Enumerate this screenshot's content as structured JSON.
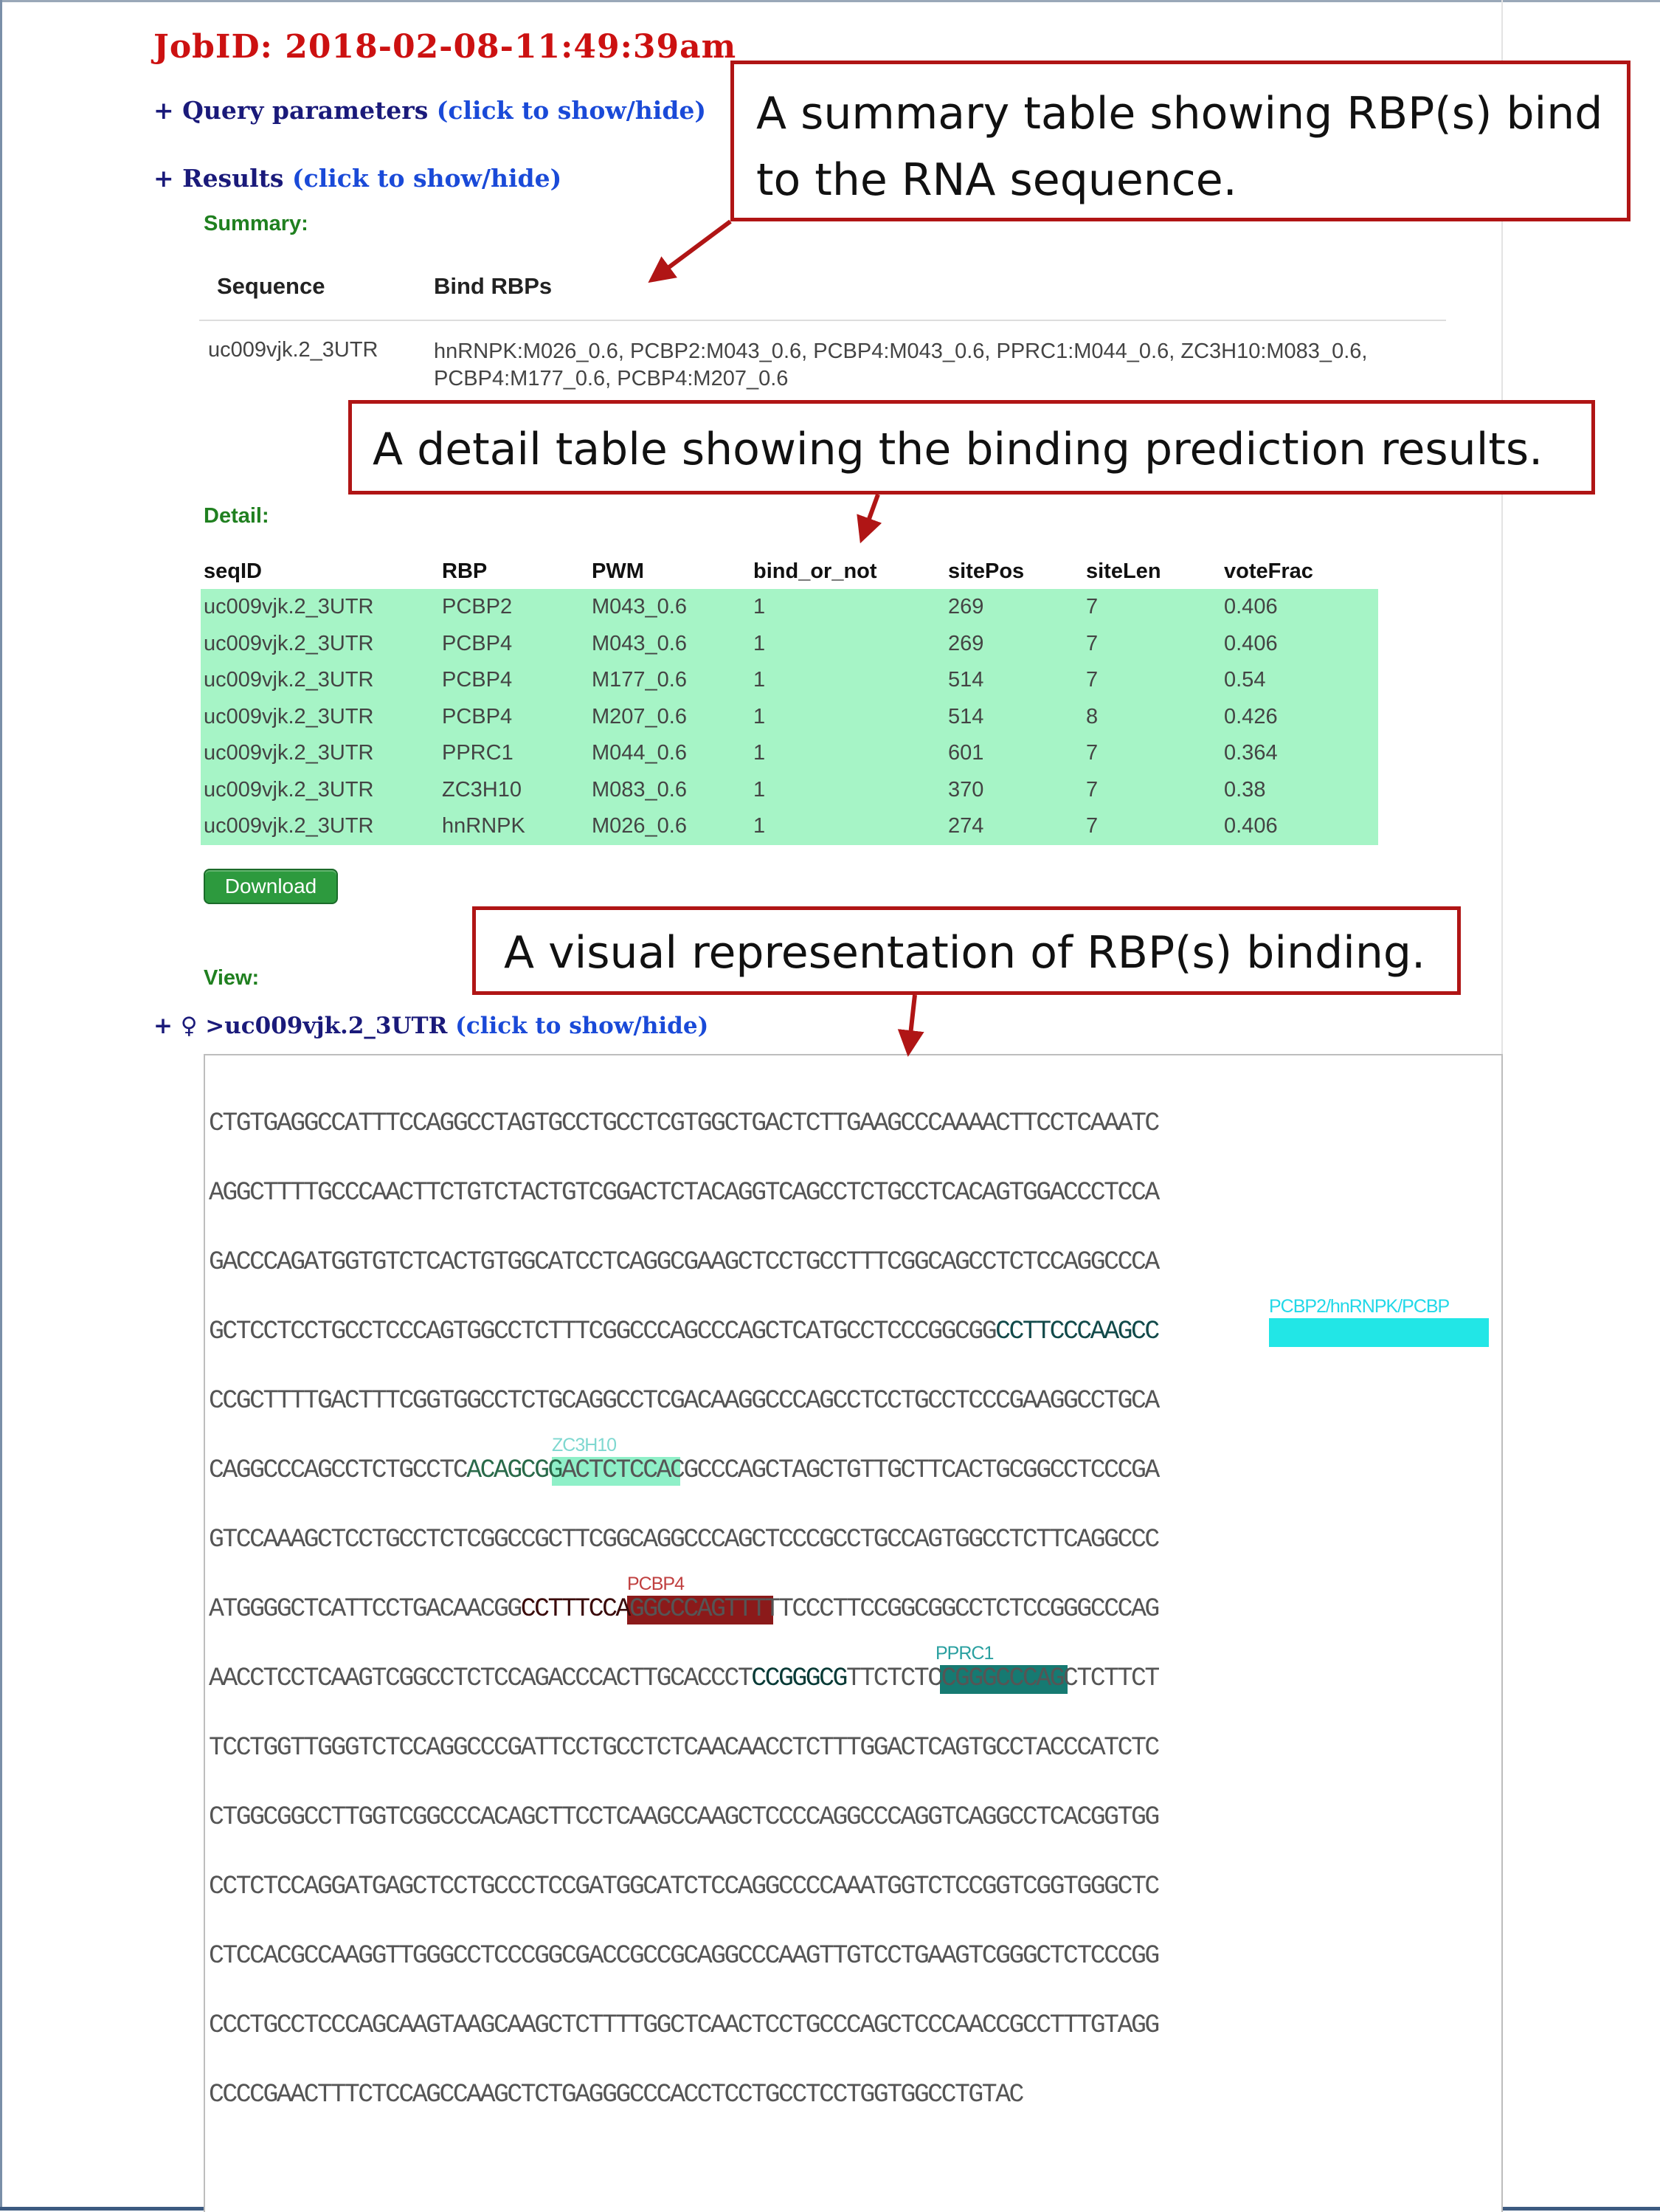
{
  "job": {
    "id": "JobID: 2018-02-08-11:49:39am"
  },
  "query_toggle": {
    "plus": "+ ",
    "label": "Query parameters",
    "link": "(click to show/hide)"
  },
  "results_toggle": {
    "plus": "+ ",
    "label": "Results",
    "link": "(click to show/hide)"
  },
  "summary": {
    "heading": "Summary:",
    "columns": [
      "Sequence",
      "Bind RBPs"
    ],
    "row": {
      "sequence": "uc009vjk.2_3UTR",
      "rbps": "hnRNPK:M026_0.6, PCBP2:M043_0.6, PCBP4:M043_0.6, PPRC1:M044_0.6, ZC3H10:M083_0.6, PCBP4:M177_0.6, PCBP4:M207_0.6"
    }
  },
  "detail": {
    "heading": "Detail:",
    "columns": [
      "seqID",
      "RBP",
      "PWM",
      "bind_or_not",
      "sitePos",
      "siteLen",
      "voteFrac"
    ],
    "rows": [
      [
        "uc009vjk.2_3UTR",
        "PCBP2",
        "M043_0.6",
        "1",
        "269",
        "7",
        "0.406"
      ],
      [
        "uc009vjk.2_3UTR",
        "PCBP4",
        "M043_0.6",
        "1",
        "269",
        "7",
        "0.406"
      ],
      [
        "uc009vjk.2_3UTR",
        "PCBP4",
        "M177_0.6",
        "1",
        "514",
        "7",
        "0.54"
      ],
      [
        "uc009vjk.2_3UTR",
        "PCBP4",
        "M207_0.6",
        "1",
        "514",
        "8",
        "0.426"
      ],
      [
        "uc009vjk.2_3UTR",
        "PPRC1",
        "M044_0.6",
        "1",
        "601",
        "7",
        "0.364"
      ],
      [
        "uc009vjk.2_3UTR",
        "ZC3H10",
        "M083_0.6",
        "1",
        "370",
        "7",
        "0.38"
      ],
      [
        "uc009vjk.2_3UTR",
        "hnRNPK",
        "M026_0.6",
        "1",
        "274",
        "7",
        "0.406"
      ]
    ],
    "download_label": "Download"
  },
  "view": {
    "heading": "View:",
    "toggle_prefix": "+ ",
    "toggle_icon": "♀",
    "toggle_seq": " >uc009vjk.2_3UTR ",
    "toggle_link": "(click to show/hide)",
    "sequence_lines": [
      {
        "pre": "CTGTGAGGCCATTTCCAGGCCTAGTGCCTGCCTCGTGGCTGACTCTTGAAGCCCAAAACTTCCTCAAATC",
        "hl": "",
        "post": ""
      },
      {
        "pre": "AGGCTTTTGCCCAACTTCTGTCTACTGTCGGACTCTACAGGTCAGCCTCTGCCTCACAGTGGACCCTCCA",
        "hl": "",
        "post": ""
      },
      {
        "pre": "GACCCAGATGGTGTCTCACTGTGGCATCCTCAGGCGAAGCTCCTGCCTTTCGGCAGCCTCTCCAGGCCCA",
        "hl": "",
        "post": ""
      },
      {
        "pre": "GCTCCTCCTGCCTCCCAGTGGCCTCTTTCGGCCCAGCCCAGCTCATGCCTCCCGGCGG",
        "hl": "CCTTCCCAAGCC",
        "post": ""
      },
      {
        "pre": "CCGCTTTTGACTTTCGGTGGCCTCTGCAGGCCTCGACAAGGCCCAGCCTCCTGCCTCCCGAAGGCCTGCA",
        "hl": "",
        "post": ""
      },
      {
        "pre": "CAGGCCCAGCCTCTGCCTC",
        "hl": "ACAGCGG",
        "post": "ACTCTCCACGCCCAGCTAGCTGTTGCTTCACTGCGGCCTCCCGA"
      },
      {
        "pre": "GTCCAAAGCTCCTGCCTCTCGGCCGCTTCGGCAGGCCCAGCTCCCGCCTGCCAGTGGCCTCTTCAGGCCC",
        "hl": "",
        "post": ""
      },
      {
        "pre": "ATGGGGCTCATTCCTGACAACGG",
        "hl": "CCTTTCCA",
        "post": "GGCCCAGTTTTTCCCTTCCGGCGGCCTCTCCGGGCCCAG"
      },
      {
        "pre": "AACCTCCTCAAGTCGGCCTCTCCAGACCCACTTGCACCCT",
        "hl": "CCGGGCG",
        "post": "TTCTCTCCGGGCCCAGCTCTTCT"
      },
      {
        "pre": "TCCTGGTTGGGTCTCCAGGCCCGATTCCTGCCTCTCAACAACCTCTTTGGACTCAGTGCCTACCCATCTC",
        "hl": "",
        "post": ""
      },
      {
        "pre": "CTGGCGGCCTTGGTCGGCCCACAGCTTCCTCAAGCCAAGCTCCCCAGGCCCAGGTCAGGCCTCACGGTGG",
        "hl": "",
        "post": ""
      },
      {
        "pre": "CCTCTCCAGGATGAGCTCCTGCCCTCCGATGGCATCTCCAGGCCCCAAATGGTCTCCGGTCGGTGGGCTC",
        "hl": "",
        "post": ""
      },
      {
        "pre": "CTCCACGCCAAGGTTGGGCCTCCCGGCGACCGCCGCAGGCCCAAGTTGTCCTGAAGTCGGGCTCTCCCGG",
        "hl": "",
        "post": ""
      },
      {
        "pre": "CCCTGCCTCCCAGCAAGTAAGCAAGCTCTTTTGGCTCAACTCCTGCCCAGCTCCCAACCGCCTTTGTAGG",
        "hl": "",
        "post": ""
      },
      {
        "pre": "CCCCGAACTTTCTCCAGCCAAGCTCTGAGGGCCCACCTCCTGCCTCCTGGTGGCCTGTAC",
        "hl": "",
        "post": ""
      }
    ],
    "site_labels": {
      "pcbp2_group": "PCBP2/hnRNPK/PCBP",
      "zc3h10": "ZC3H10",
      "pcbp4": "PCBP4",
      "pprc1": "PPRC1"
    }
  },
  "callouts": {
    "summary_line1": "A summary table showing RBP(s) bind",
    "summary_line2": "to the RNA sequence.",
    "detail": "A detail table showing the binding prediction results.",
    "view": "A visual representation of RBP(s) binding."
  },
  "colors": {
    "cyan_site": "#22e6e6",
    "zc3h10_site": "#8ff0c8",
    "pcbp4_site": "#8b1a1a",
    "pprc1_site": "#167a72",
    "table_row": "#a6f4c6",
    "callout_border": "#b01515"
  }
}
